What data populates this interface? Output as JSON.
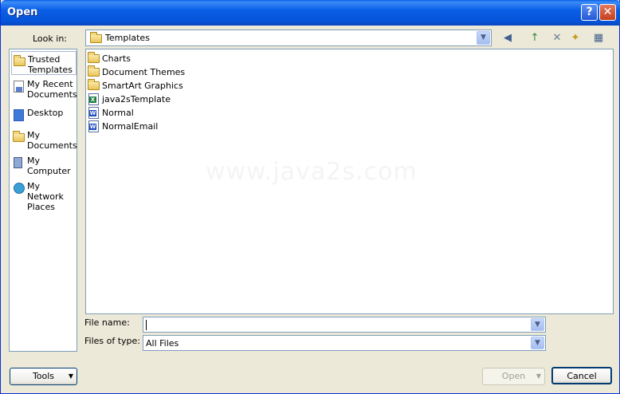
{
  "window": {
    "title": "Open",
    "help_glyph": "?",
    "close_glyph": "✕"
  },
  "look_in": {
    "label": "Look in:",
    "value": "Templates"
  },
  "toolbar": {
    "back_glyph": "◀",
    "up_glyph": "↑",
    "delete_glyph": "✕",
    "new_folder_glyph": "✦",
    "views_glyph": "▦"
  },
  "places": [
    {
      "label": "Trusted Templates",
      "icon": "folder-icon",
      "selected": true
    },
    {
      "label": "My Recent Documents",
      "icon": "recent-documents-icon",
      "selected": false
    },
    {
      "label": "Desktop",
      "icon": "desktop-icon",
      "selected": false
    },
    {
      "label": "My Documents",
      "icon": "my-documents-icon",
      "selected": false
    },
    {
      "label": "My Computer",
      "icon": "my-computer-icon",
      "selected": false
    },
    {
      "label": "My Network Places",
      "icon": "network-places-icon",
      "selected": false
    }
  ],
  "files": [
    {
      "name": "Charts",
      "type": "folder"
    },
    {
      "name": "Document Themes",
      "type": "folder"
    },
    {
      "name": "SmartArt Graphics",
      "type": "folder"
    },
    {
      "name": "java2sTemplate",
      "type": "excel"
    },
    {
      "name": "Normal",
      "type": "word"
    },
    {
      "name": "NormalEmail",
      "type": "word"
    }
  ],
  "watermark": "www.java2s.com",
  "file_name": {
    "label": "File name:",
    "value": ""
  },
  "files_of_type": {
    "label": "Files of type:",
    "value": "All Files"
  },
  "buttons": {
    "tools": "Tools",
    "open": "Open",
    "cancel": "Cancel"
  },
  "colors": {
    "title_bar": "#0a5ee6",
    "dialog_bg": "#ece9d8",
    "input_border": "#7f9db9"
  }
}
